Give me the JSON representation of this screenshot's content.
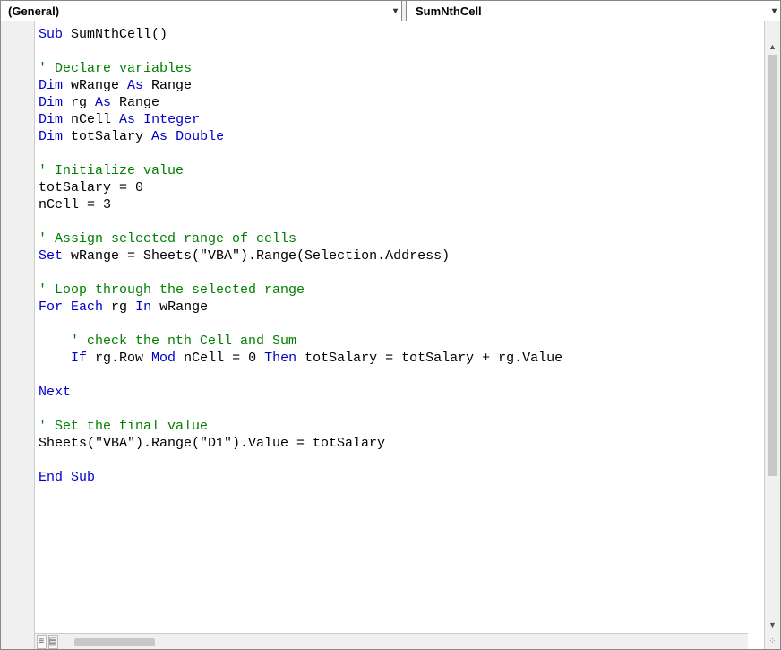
{
  "dropdowns": {
    "scope": "(General)",
    "procedure": "SumNthCell"
  },
  "code": {
    "lines": [
      [
        {
          "cls": "kw",
          "t": "Sub"
        },
        {
          "cls": "tx",
          "t": " SumNthCell()"
        }
      ],
      [],
      [
        {
          "cls": "cm",
          "t": "' Declare variables"
        }
      ],
      [
        {
          "cls": "kw",
          "t": "Dim"
        },
        {
          "cls": "tx",
          "t": " wRange "
        },
        {
          "cls": "kw",
          "t": "As"
        },
        {
          "cls": "tx",
          "t": " Range"
        }
      ],
      [
        {
          "cls": "kw",
          "t": "Dim"
        },
        {
          "cls": "tx",
          "t": " rg "
        },
        {
          "cls": "kw",
          "t": "As"
        },
        {
          "cls": "tx",
          "t": " Range"
        }
      ],
      [
        {
          "cls": "kw",
          "t": "Dim"
        },
        {
          "cls": "tx",
          "t": " nCell "
        },
        {
          "cls": "kw",
          "t": "As"
        },
        {
          "cls": "tx",
          "t": " "
        },
        {
          "cls": "kw",
          "t": "Integer"
        }
      ],
      [
        {
          "cls": "kw",
          "t": "Dim"
        },
        {
          "cls": "tx",
          "t": " totSalary "
        },
        {
          "cls": "kw",
          "t": "As"
        },
        {
          "cls": "tx",
          "t": " "
        },
        {
          "cls": "kw",
          "t": "Double"
        }
      ],
      [],
      [
        {
          "cls": "cm",
          "t": "' Initialize value"
        }
      ],
      [
        {
          "cls": "tx",
          "t": "totSalary = 0"
        }
      ],
      [
        {
          "cls": "tx",
          "t": "nCell = 3"
        }
      ],
      [],
      [
        {
          "cls": "cm",
          "t": "' Assign selected range of cells"
        }
      ],
      [
        {
          "cls": "kw",
          "t": "Set"
        },
        {
          "cls": "tx",
          "t": " wRange = Sheets(\"VBA\").Range(Selection.Address)"
        }
      ],
      [],
      [
        {
          "cls": "cm",
          "t": "' Loop through the selected range"
        }
      ],
      [
        {
          "cls": "kw",
          "t": "For"
        },
        {
          "cls": "tx",
          "t": " "
        },
        {
          "cls": "kw",
          "t": "Each"
        },
        {
          "cls": "tx",
          "t": " rg "
        },
        {
          "cls": "kw",
          "t": "In"
        },
        {
          "cls": "tx",
          "t": " wRange"
        }
      ],
      [],
      [
        {
          "cls": "tx",
          "t": "    "
        },
        {
          "cls": "cm",
          "t": "' check the nth Cell and Sum"
        }
      ],
      [
        {
          "cls": "tx",
          "t": "    "
        },
        {
          "cls": "kw",
          "t": "If"
        },
        {
          "cls": "tx",
          "t": " rg.Row "
        },
        {
          "cls": "kw",
          "t": "Mod"
        },
        {
          "cls": "tx",
          "t": " nCell = 0 "
        },
        {
          "cls": "kw",
          "t": "Then"
        },
        {
          "cls": "tx",
          "t": " totSalary = totSalary + rg.Value"
        }
      ],
      [],
      [
        {
          "cls": "kw",
          "t": "Next"
        }
      ],
      [],
      [
        {
          "cls": "cm",
          "t": "' Set the final value"
        }
      ],
      [
        {
          "cls": "tx",
          "t": "Sheets(\"VBA\").Range(\"D1\").Value = totSalary"
        }
      ],
      [],
      [
        {
          "cls": "kw",
          "t": "End"
        },
        {
          "cls": "tx",
          "t": " "
        },
        {
          "cls": "kw",
          "t": "Sub"
        }
      ]
    ]
  },
  "icons": {
    "chevron_down": "▾",
    "arrow_up": "▲",
    "arrow_down": "▼",
    "procedure_view": "≡",
    "full_view": "▤",
    "resize": "⁘"
  }
}
